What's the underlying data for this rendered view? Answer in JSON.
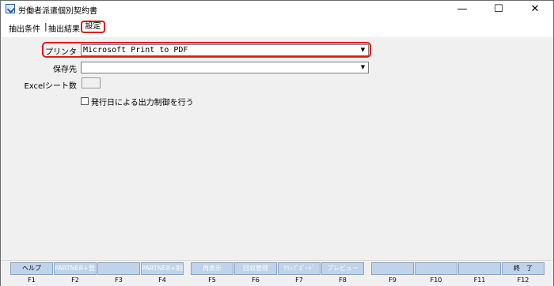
{
  "window": {
    "title": "労働者派遣個別契約書",
    "controls": {
      "minimize": "—",
      "maximize": "☐",
      "close": "✕"
    }
  },
  "tabs": [
    {
      "label": "抽出条件"
    },
    {
      "label": "抽出結果"
    },
    {
      "label": "設定"
    }
  ],
  "tab_separator": "|",
  "form": {
    "printer": {
      "label": "プリンタ",
      "value": "Microsoft Print to PDF"
    },
    "save_to": {
      "label": "保存先",
      "value": ""
    },
    "excel_sheets": {
      "label": "Excelシート数",
      "value": ""
    },
    "issue_date_control": {
      "label": "発行日による出力制御を行う",
      "checked": false
    }
  },
  "fkeys": [
    {
      "key": "F1",
      "label": "ヘルプ"
    },
    {
      "key": "F2",
      "label": "PARTNER+登録"
    },
    {
      "key": "F3",
      "label": ""
    },
    {
      "key": "F4",
      "label": "PARTNER+削除"
    },
    {
      "key": "F5",
      "label": "再表示"
    },
    {
      "key": "F6",
      "label": "回収管理"
    },
    {
      "key": "F7",
      "label": "ｸﾘｯﾌﾟﾎﾞｰﾄﾞ"
    },
    {
      "key": "F8",
      "label": "プレビュー"
    },
    {
      "key": "F9",
      "label": ""
    },
    {
      "key": "F10",
      "label": ""
    },
    {
      "key": "F11",
      "label": ""
    },
    {
      "key": "F12",
      "label": "終　了"
    }
  ]
}
